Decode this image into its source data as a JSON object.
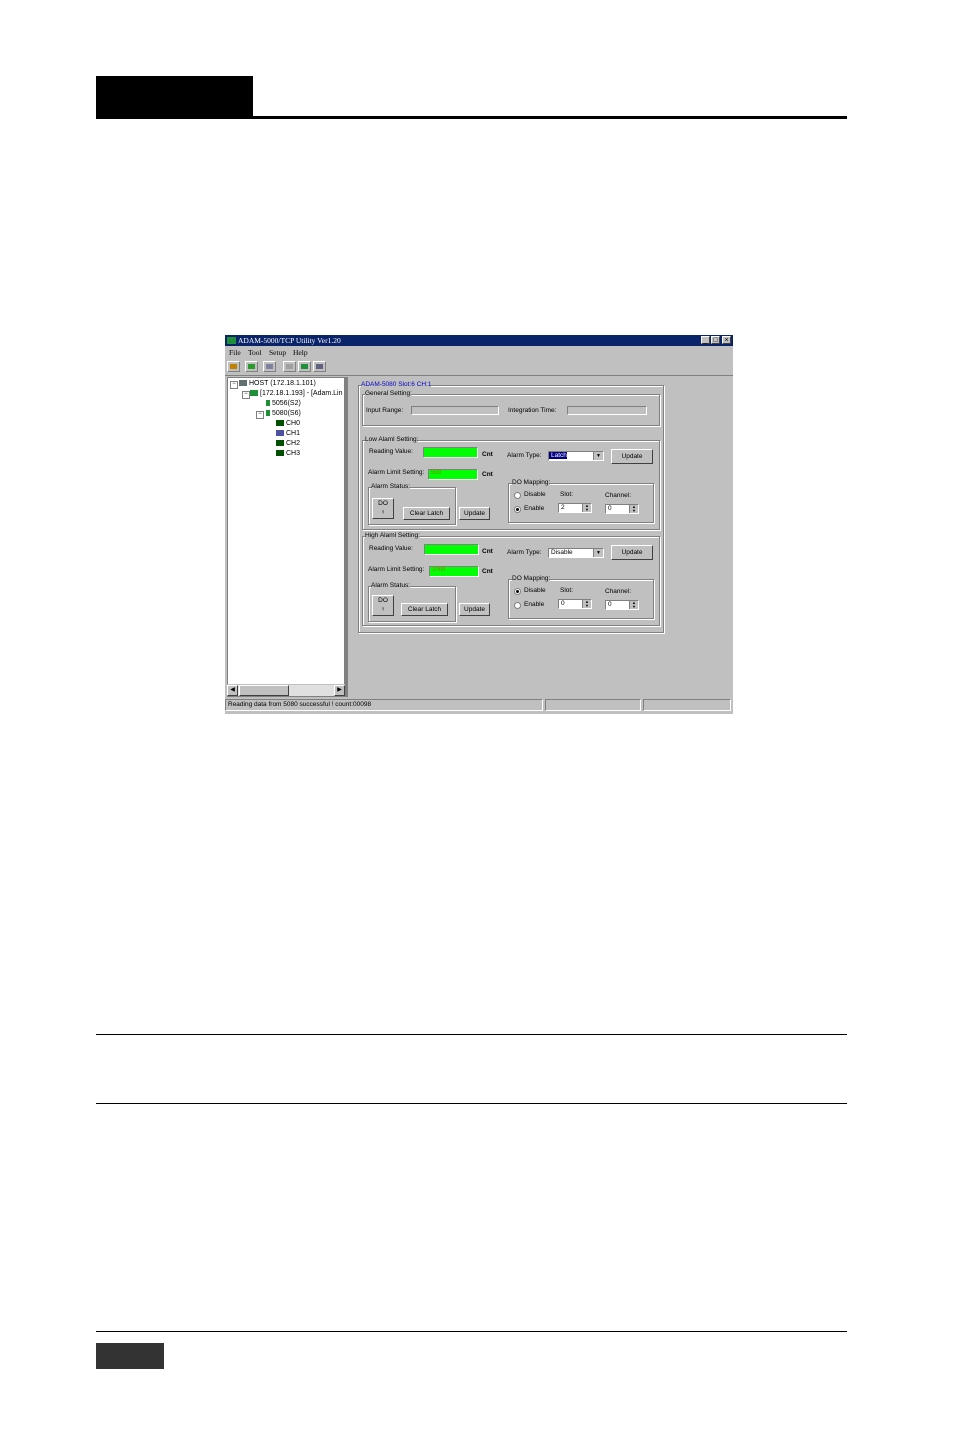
{
  "window": {
    "title": "ADAM-5000/TCP Utility Ver1.20",
    "controls": [
      "_",
      "□",
      "×"
    ]
  },
  "menu": [
    "File",
    "Tool",
    "Setup",
    "Help"
  ],
  "tree": {
    "host": "HOST (172.18.1.101)",
    "device": "[172.18.1.193] - [Adam.Lin",
    "modules": [
      "5056(S2)",
      "5080(S6)"
    ],
    "channels": [
      "CH0",
      "CH1",
      "CH2",
      "CH3"
    ]
  },
  "panel": {
    "heading": "ADAM-5080  Slot:6 CH:1",
    "general": {
      "title": "General Setting:",
      "input_range_label": "Input Range:",
      "integration_time_label": "Integration Time:"
    },
    "low": {
      "title": "Low Alaml Setting:",
      "reading_label": "Reading Value:",
      "reading_value": "",
      "limit_label": "Alarm Limit Setting:",
      "limit_value": "500",
      "unit": "Cnt",
      "alarm_type_label": "Alarm Type:",
      "alarm_type_value": "Latch",
      "update_label": "Update",
      "status_title": "Alarm Status:",
      "do_label": "DO",
      "clear_latch_label": "Clear Latch",
      "update2_label": "Update",
      "mapping_title": "DO Mapping:",
      "disable_label": "Disable",
      "enable_label": "Enable",
      "slot_label": "Slot:",
      "channel_label": "Channel:",
      "slot_value": "2",
      "channel_value": "0"
    },
    "high": {
      "title": "High Alaml Setting:",
      "reading_label": "Reading Value:",
      "reading_value": "",
      "limit_label": "Alarm Limit Setting:",
      "limit_value": "1000",
      "unit": "Cnt",
      "alarm_type_label": "Alarm Type:",
      "alarm_type_value": "Disable",
      "update_label": "Update",
      "status_title": "Alarm Status:",
      "do_label": "DO",
      "clear_latch_label": "Clear Latch",
      "update2_label": "Update",
      "mapping_title": "DO Mapping:",
      "disable_label": "Disable",
      "enable_label": "Enable",
      "slot_label": "Slot:",
      "channel_label": "Channel:",
      "slot_value": "0",
      "channel_value": "0"
    }
  },
  "status": {
    "message": "Reading data from 5080 successful !  count:00098"
  }
}
